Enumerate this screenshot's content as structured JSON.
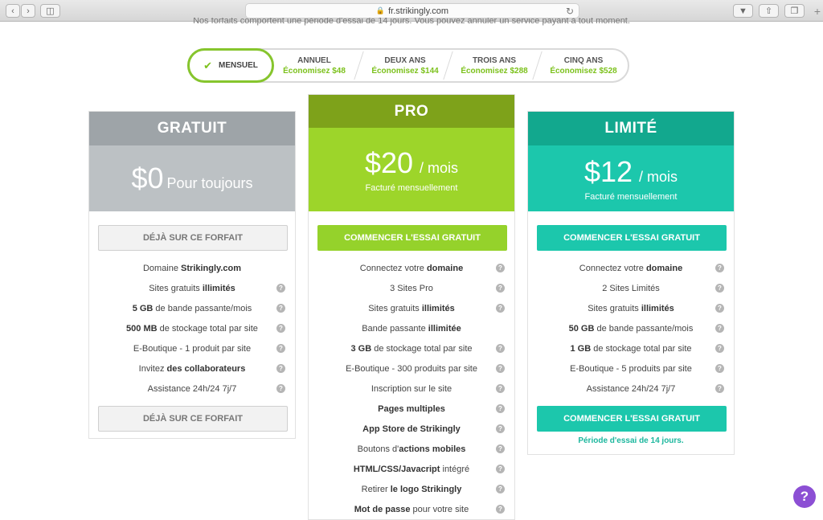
{
  "browser": {
    "url": "fr.strikingly.com",
    "back_icon": "chevron-left-icon",
    "forward_icon": "chevron-right-icon",
    "sidebar_icon": "sidebar-icon"
  },
  "subtitle": "Nos forfaits comportent une période d'essai de 14 jours. Vous pouvez annuler un service payant à tout moment.",
  "billing": {
    "active": "MENSUEL",
    "options": [
      {
        "label": "ANNUEL",
        "saving": "Économisez $48"
      },
      {
        "label": "DEUX ANS",
        "saving": "Économisez $144"
      },
      {
        "label": "TROIS ANS",
        "saving": "Économisez $288"
      },
      {
        "label": "CINQ ANS",
        "saving": "Économisez $528"
      }
    ]
  },
  "plans": {
    "free": {
      "name": "GRATUIT",
      "price": "$0",
      "period": "Pour toujours",
      "button": "DÉJÀ SUR CE FORFAIT",
      "button_bottom": "DÉJÀ SUR CE FORFAIT",
      "color_head": "#9ea4a8",
      "color_band": "#bcc1c4"
    },
    "pro": {
      "name": "PRO",
      "price": "$20",
      "period": "/ mois",
      "billed": "Facturé mensuellement",
      "button": "COMMENCER L'ESSAI GRATUIT",
      "color_head": "#7ea21a",
      "color_band": "#9dd52a"
    },
    "limited": {
      "name": "LIMITÉ",
      "price": "$12",
      "period": "/ mois",
      "billed": "Facturé mensuellement",
      "button": "COMMENCER L'ESSAI GRATUIT",
      "button_bottom": "COMMENCER L'ESSAI GRATUIT",
      "trial_note": "Période d'essai de 14 jours.",
      "color_head": "#12a88e",
      "color_band": "#1cc7ac"
    }
  },
  "help_label": "?"
}
